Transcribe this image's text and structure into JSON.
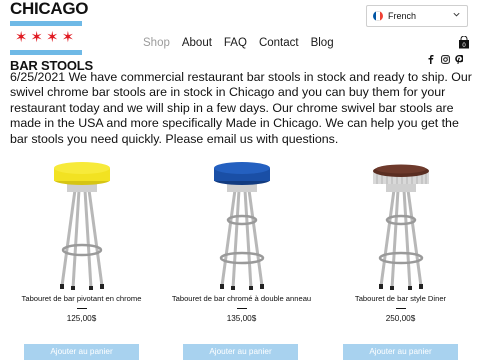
{
  "logo": {
    "top": "CHICAGO",
    "stars": "✶✶✶✶",
    "bottom": "BAR STOOLS"
  },
  "nav": [
    "Shop",
    "About",
    "FAQ",
    "Contact",
    "Blog"
  ],
  "nav_active": "Shop",
  "language": {
    "selected": "French",
    "flag_colors": [
      "#0055a4",
      "#ffffff",
      "#ef4135"
    ]
  },
  "social_icons": [
    "facebook-icon",
    "instagram-icon",
    "pinterest-icon"
  ],
  "cart_count": "0",
  "intro_text": "6/25/2021 We have commercial restaurant bar stools in stock and ready to ship. Our swivel chrome bar stools are in stock in Chicago and you can buy them for your restaurant today and we will ship in a few days.  Our chrome swivel bar stools are made in the USA and more specifically Made in Chicago.  We can help you get the bar stools you need quickly.  Please email us with questions.",
  "products": [
    {
      "name": "Tabouret de bar pivotant en chrome",
      "price": "125,00$",
      "button": "Ajouter au panier",
      "seat_color": "#f2e222"
    },
    {
      "name": "Tabouret de bar chromé à double anneau",
      "price": "135,00$",
      "button": "Ajouter au panier",
      "seat_color": "#1a4fa6"
    },
    {
      "name": "Tabouret de bar style Diner",
      "price": "250,00$",
      "button": "Ajouter au panier",
      "seat_color": "#5a2e22"
    }
  ],
  "colors": {
    "accent_button": "#a8d2ef",
    "nav_active": "#9c9c9c",
    "flag_blue": "#6fb9e6",
    "flag_red": "#e01b22"
  }
}
